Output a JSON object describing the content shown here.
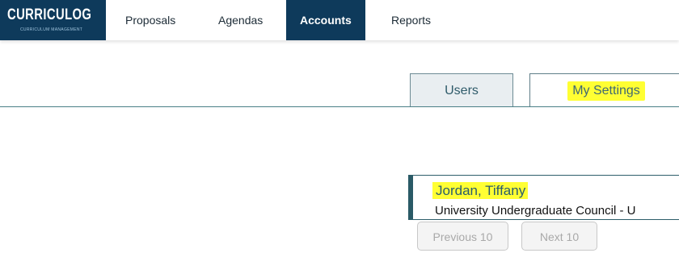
{
  "app": {
    "logo_text": "CURRICULOG",
    "logo_tagline": "CURRICULUM MANAGEMENT"
  },
  "nav": {
    "items": [
      {
        "label": "Proposals",
        "active": false
      },
      {
        "label": "Agendas",
        "active": false
      },
      {
        "label": "Accounts",
        "active": true
      },
      {
        "label": "Reports",
        "active": false
      }
    ]
  },
  "tabs": [
    {
      "label": "Users",
      "selected": false
    },
    {
      "label": "My Settings",
      "selected": true,
      "highlighted": true
    }
  ],
  "user_card": {
    "name": "Jordan, Tiffany",
    "organization": "University Undergraduate Council - U"
  },
  "pagination": {
    "previous_label": "Previous 10",
    "next_label": "Next 10",
    "previous_enabled": false,
    "next_enabled": false
  },
  "colors": {
    "brand": "#0e3a5b",
    "highlight": "#ffff33",
    "accent": "#2a5a66"
  }
}
